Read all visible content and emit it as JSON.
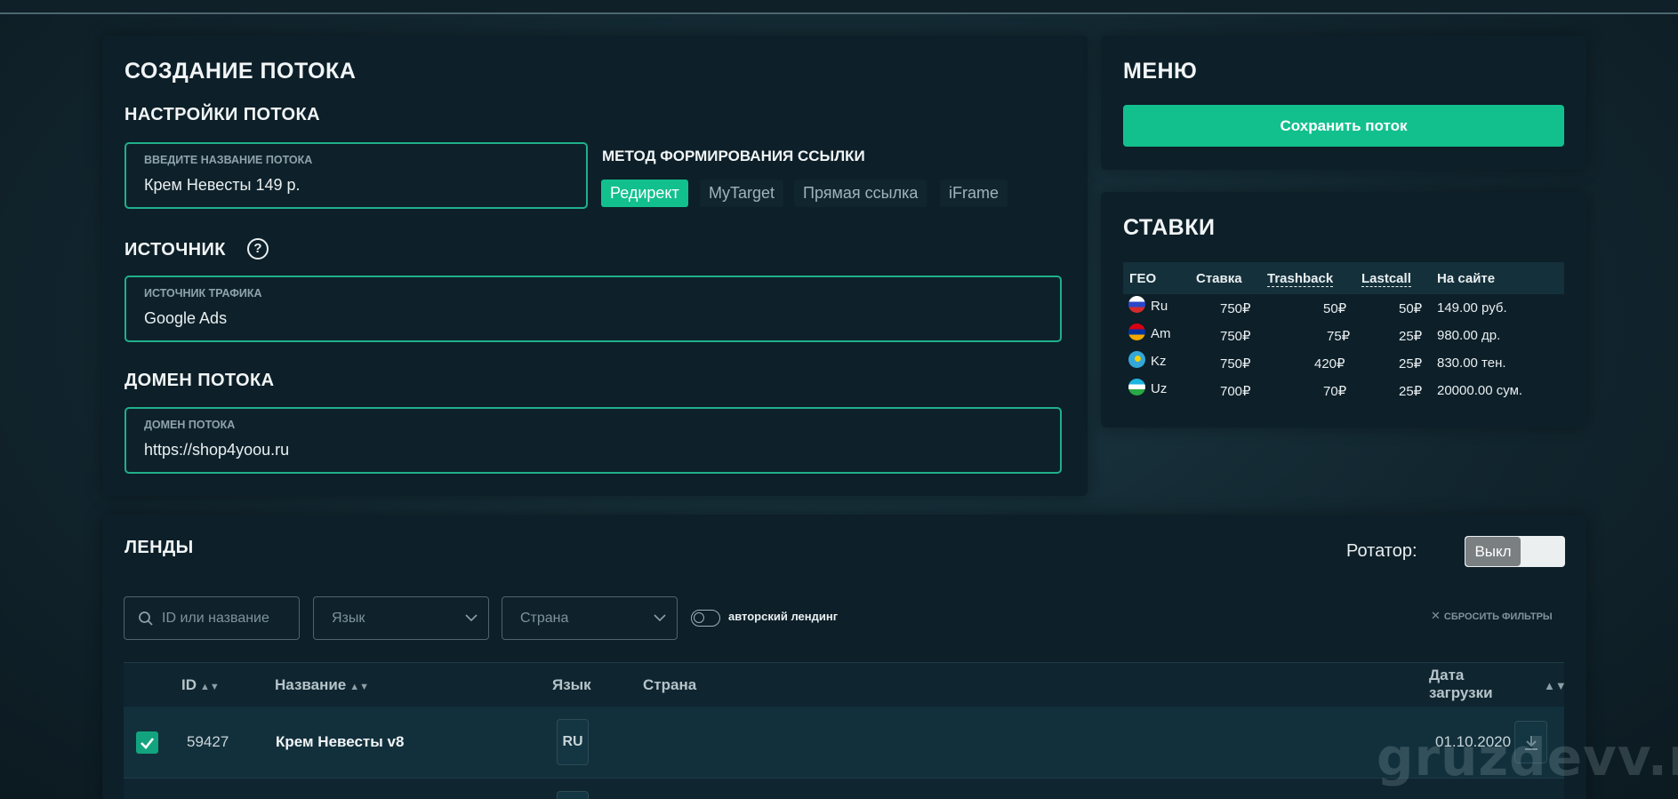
{
  "create": {
    "title": "СОЗДАНИЕ ПОТОКА",
    "settings_title": "НАСТРОЙКИ ПОТОКА",
    "name_field": {
      "label": "ВВЕДИТЕ НАЗВАНИЕ ПОТОКА",
      "value": "Крем Невесты 149 р."
    },
    "method": {
      "title": "МЕТОД ФОРМИРОВАНИЯ ССЫЛКИ",
      "options": [
        "Редирект",
        "MyTarget",
        "Прямая ссылка",
        "iFrame"
      ],
      "selected": "Редирект"
    },
    "source_title": "ИСТОЧНИК",
    "source_field": {
      "label": "ИСТОЧНИК ТРАФИКА",
      "value": "Google Ads"
    },
    "domain_title": "ДОМЕН ПОТОКА",
    "domain_field": {
      "label": "ДОМЕН ПОТОКА",
      "value": "https://shop4yoou.ru"
    }
  },
  "menu": {
    "title": "МЕНЮ",
    "save_label": "Сохранить поток"
  },
  "rates": {
    "title": "СТАВКИ",
    "headers": [
      "ГЕО",
      "Ставка",
      "Trashback",
      "Lastcall",
      "На сайте"
    ],
    "rows": [
      {
        "geo": "Ru",
        "rate": "750₽",
        "trashback": "50₽",
        "lastcall": "50₽",
        "site": "149.00 руб.",
        "flag": "flag-ru"
      },
      {
        "geo": "Am",
        "rate": "750₽",
        "trashback": "75₽",
        "lastcall": "25₽",
        "site": "980.00 др.",
        "flag": "flag-am"
      },
      {
        "geo": "Kz",
        "rate": "750₽",
        "trashback": "420₽",
        "lastcall": "25₽",
        "site": "830.00 тен.",
        "flag": "flag-kz"
      },
      {
        "geo": "Uz",
        "rate": "700₽",
        "trashback": "70₽",
        "lastcall": "25₽",
        "site": "20000.00 сум.",
        "flag": "flag-uz"
      }
    ]
  },
  "landings": {
    "title": "ЛЕНДЫ",
    "rotator_label": "Ротатор:",
    "rotator_state": "Выкл",
    "search_placeholder": "ID или название",
    "language_placeholder": "Язык",
    "country_placeholder": "Страна",
    "author_label": "авторский лендинг",
    "reset_label": "СБРОСИТЬ ФИЛЬТРЫ",
    "columns": {
      "id": "ID",
      "name": "Название",
      "lang": "Язык",
      "country": "Страна",
      "date": "Дата загрузки"
    },
    "rows": [
      {
        "id": "59427",
        "name": "Крем Невесты v8",
        "lang": "RU",
        "country": "",
        "date": "01.10.2020",
        "checked": true
      }
    ]
  },
  "watermark": "gruzdevv.ru",
  "colors": {
    "accent": "#12c08e",
    "card": "#0d1f28",
    "field_border": "#1fb08a"
  }
}
